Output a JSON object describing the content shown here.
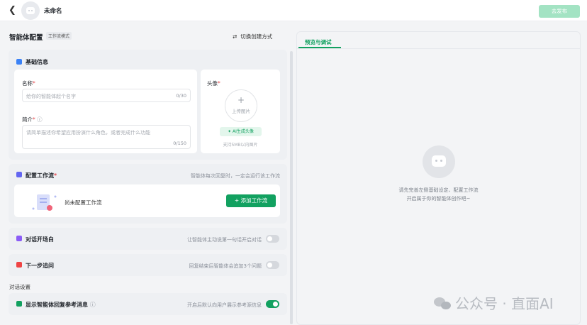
{
  "header": {
    "agent_name": "未命名",
    "publish_label": "去发布"
  },
  "config": {
    "title": "智能体配置",
    "mode_tag": "工作流模式",
    "switch_label": "切换创建方式"
  },
  "basic": {
    "title": "基础信息",
    "name_label": "名称",
    "name_placeholder": "给你的智能体起个名字",
    "name_count": "0/30",
    "intro_label": "简介",
    "intro_placeholder": "请简单描述你希望应用扮演什么角色，或者完成什么功能",
    "intro_count": "0/150",
    "avatar_label": "头像",
    "upload_label": "上传图片",
    "ai_avatar_label": "AI生成头像",
    "size_tip": "支持5MB以内图片"
  },
  "workflow": {
    "title": "配置工作流",
    "hint": "智能体每次回复时，一定会运行该工作流",
    "empty_text": "尚未配置工作流",
    "add_label": "+ 添加工作流"
  },
  "opening": {
    "title": "对话开场白",
    "hint": "让智能体主动说第一句话开启对话",
    "enabled": false
  },
  "next_step": {
    "title": "下一步追问",
    "hint": "回复结束后智能体会追加3个问题",
    "enabled": false
  },
  "dialog_settings": {
    "label": "对话设置",
    "ref_title": "显示智能体回复参考消息",
    "ref_hint": "开启后默认向用户展示参考源信息",
    "ref_enabled": true
  },
  "preview": {
    "tab_label": "预览与调试",
    "empty_line1": "请先完善左侧基础设定、配置工作流",
    "empty_line2": "开启属于你的智能体创作吧~"
  },
  "watermark": "公众号 · 直面AI",
  "colors": {
    "accent": "#12a160",
    "publish_disabled": "#a3e3c3"
  },
  "icons": [
    "back-arrow-icon",
    "bot-avatar-icon",
    "swap-icon",
    "image-icon",
    "workflow-icon",
    "chat-icon",
    "question-icon",
    "info-icon",
    "reference-icon",
    "plus-icon",
    "wechat-icon"
  ]
}
